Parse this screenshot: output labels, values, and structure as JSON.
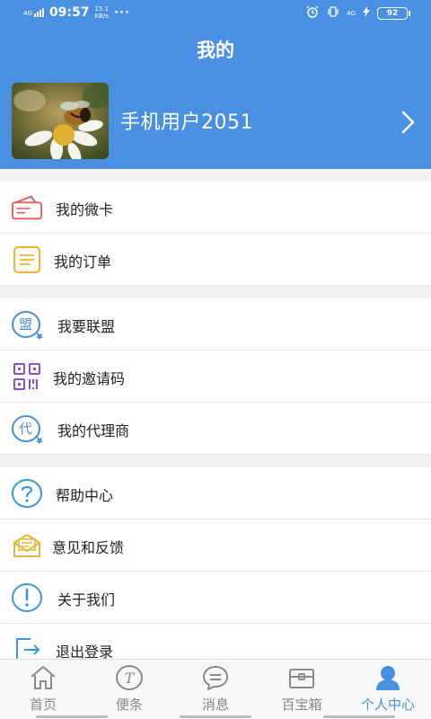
{
  "statusbar": {
    "network": "4G",
    "time": "09:57",
    "speed_value": "15.1",
    "speed_unit": "KB/s",
    "dots": "···",
    "network_right": "4G",
    "battery": "92"
  },
  "header": {
    "title": "我的",
    "username": "手机用户2051"
  },
  "menu": {
    "group1": [
      {
        "label": "我的微卡",
        "icon": "card-icon"
      },
      {
        "label": "我的订单",
        "icon": "order-icon"
      }
    ],
    "group2": [
      {
        "label": "我要联盟",
        "icon": "alliance-icon",
        "icon_text": "盟"
      },
      {
        "label": "我的邀请码",
        "icon": "qrcode-icon"
      },
      {
        "label": "我的代理商",
        "icon": "agent-icon",
        "icon_text": "代"
      }
    ],
    "group3": [
      {
        "label": "帮助中心",
        "icon": "help-icon"
      },
      {
        "label": "意见和反馈",
        "icon": "feedback-icon"
      },
      {
        "label": "关于我们",
        "icon": "info-icon"
      },
      {
        "label": "退出登录",
        "icon": "logout-icon"
      }
    ]
  },
  "tabbar": {
    "tabs": [
      {
        "label": "首页",
        "icon": "home-icon"
      },
      {
        "label": "便条",
        "icon": "note-icon"
      },
      {
        "label": "消息",
        "icon": "message-icon"
      },
      {
        "label": "百宝箱",
        "icon": "toolbox-icon"
      },
      {
        "label": "个人中心",
        "icon": "user-icon"
      }
    ],
    "active_index": 4
  },
  "colors": {
    "header_bg": "#4a90e2",
    "accent": "#4a90e2"
  }
}
